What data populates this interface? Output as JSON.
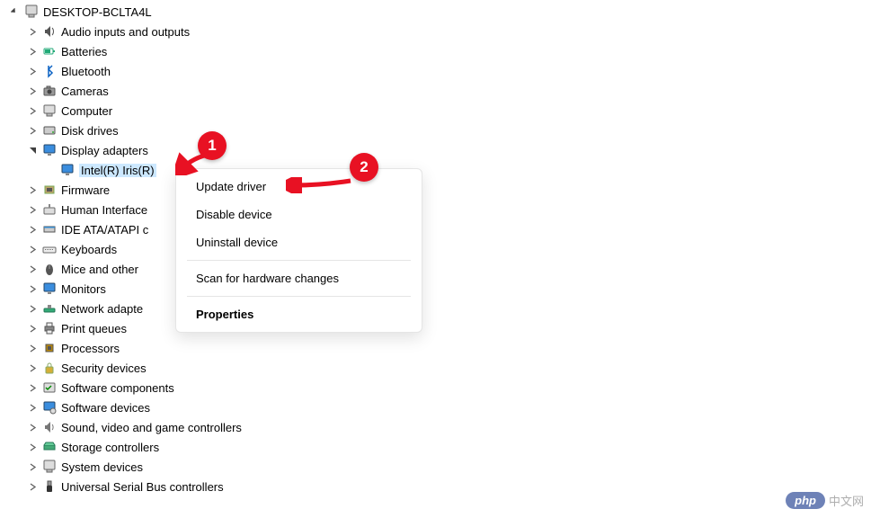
{
  "tree": {
    "root_label": "DESKTOP-BCLTA4L",
    "items": [
      {
        "label": "Audio inputs and outputs",
        "expanded": false,
        "has_children": true
      },
      {
        "label": "Batteries",
        "expanded": false,
        "has_children": true
      },
      {
        "label": "Bluetooth",
        "expanded": false,
        "has_children": true
      },
      {
        "label": "Cameras",
        "expanded": false,
        "has_children": true
      },
      {
        "label": "Computer",
        "expanded": false,
        "has_children": true
      },
      {
        "label": "Disk drives",
        "expanded": false,
        "has_children": true
      },
      {
        "label": "Display adapters",
        "expanded": true,
        "has_children": true,
        "child_label": "Intel(R) Iris(R)"
      },
      {
        "label": "Firmware",
        "expanded": false,
        "has_children": true
      },
      {
        "label": "Human Interface",
        "expanded": false,
        "has_children": true
      },
      {
        "label": "IDE ATA/ATAPI c",
        "expanded": false,
        "has_children": true
      },
      {
        "label": "Keyboards",
        "expanded": false,
        "has_children": true
      },
      {
        "label": "Mice and other",
        "expanded": false,
        "has_children": true
      },
      {
        "label": "Monitors",
        "expanded": false,
        "has_children": true
      },
      {
        "label": "Network adapte",
        "expanded": false,
        "has_children": true
      },
      {
        "label": "Print queues",
        "expanded": false,
        "has_children": true
      },
      {
        "label": "Processors",
        "expanded": false,
        "has_children": true
      },
      {
        "label": "Security devices",
        "expanded": false,
        "has_children": true
      },
      {
        "label": "Software components",
        "expanded": false,
        "has_children": true
      },
      {
        "label": "Software devices",
        "expanded": false,
        "has_children": true
      },
      {
        "label": "Sound, video and game controllers",
        "expanded": false,
        "has_children": true
      },
      {
        "label": "Storage controllers",
        "expanded": false,
        "has_children": true
      },
      {
        "label": "System devices",
        "expanded": false,
        "has_children": true
      },
      {
        "label": "Universal Serial Bus controllers",
        "expanded": false,
        "has_children": true
      }
    ]
  },
  "context_menu": {
    "items": [
      {
        "label": "Update driver",
        "bold": false
      },
      {
        "label": "Disable device",
        "bold": false
      },
      {
        "label": "Uninstall device",
        "bold": false
      }
    ],
    "items2": [
      {
        "label": "Scan for hardware changes",
        "bold": false
      }
    ],
    "items3": [
      {
        "label": "Properties",
        "bold": true
      }
    ]
  },
  "annotations": {
    "badge1": "1",
    "badge2": "2"
  },
  "watermark": {
    "pill": "php",
    "text": "中文网"
  },
  "icons": {
    "computer": "computer-icon",
    "display_adapters": "monitor-icon"
  }
}
